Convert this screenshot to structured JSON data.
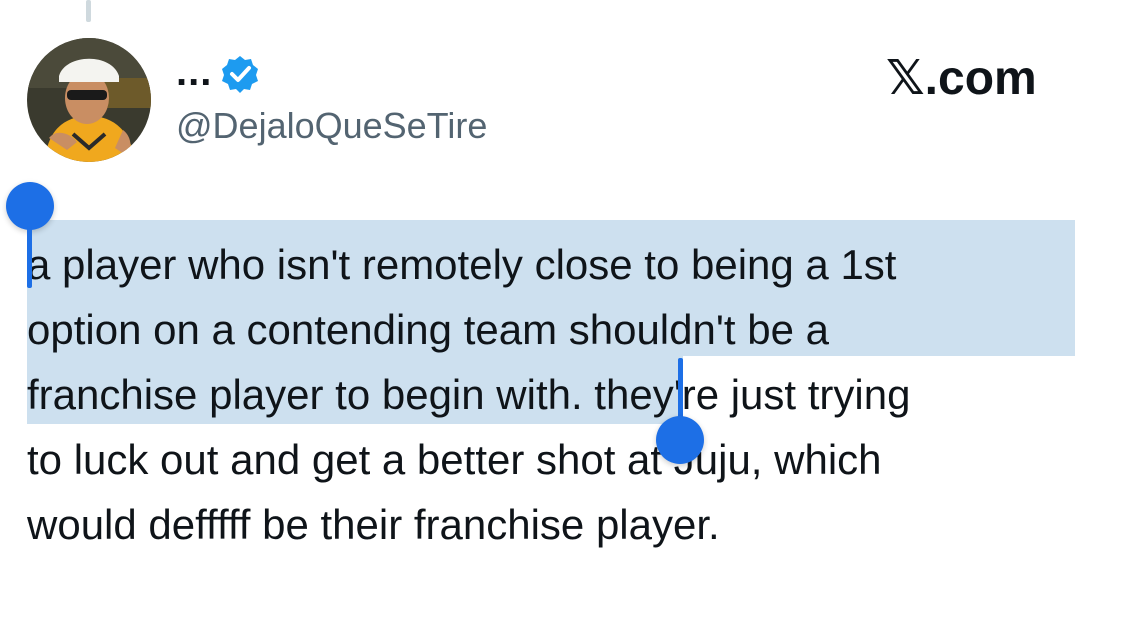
{
  "tweet": {
    "display_name": "...",
    "handle": "@DejaloQueSeTire",
    "verified_icon": "verified-badge-icon",
    "brand_label": "𝕏.com",
    "brand_icon": "x-logo-icon",
    "accent_color": "#1d9bf0",
    "selection_color": "#cde0ef",
    "selection_handle_color": "#1d6fe6",
    "lines": [
      {
        "selected": "a player who isn't remotely close to being a 1st",
        "rest": ""
      },
      {
        "selected": "option on a contending team shouldn't be a",
        "rest": ""
      },
      {
        "selected": "franchise player to begin with.",
        "rest": " they're just trying"
      },
      {
        "selected": "",
        "rest": "to luck out and get a better shot at Juju, which"
      },
      {
        "selected": "",
        "rest": "would defffff be their franchise player."
      }
    ]
  }
}
